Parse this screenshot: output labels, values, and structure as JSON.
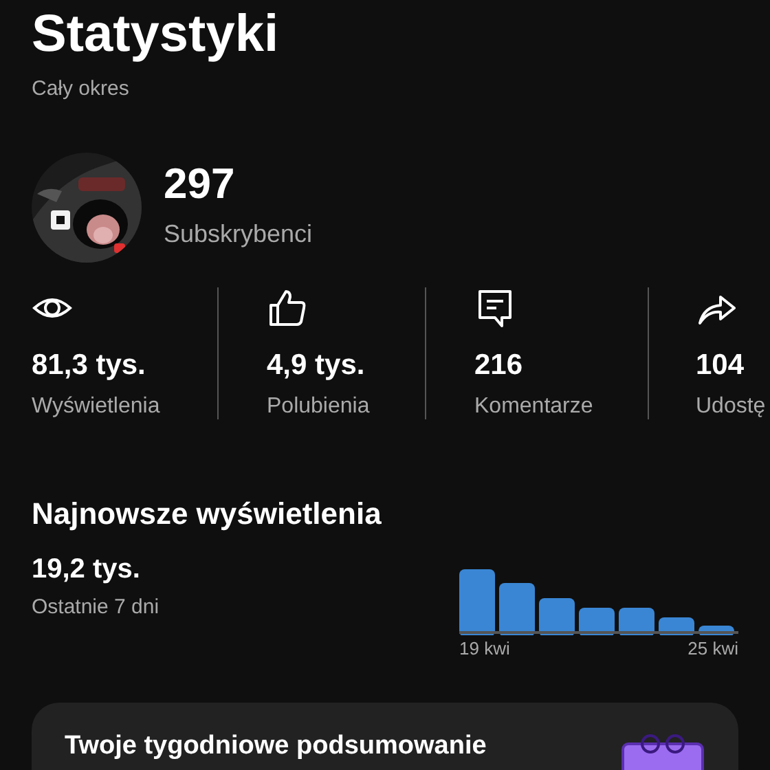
{
  "header": {
    "title": "Statystyki",
    "subtitle": "Cały okres"
  },
  "channel": {
    "count": "297",
    "label": "Subskrybenci"
  },
  "stats": [
    {
      "kind": "views",
      "value": "81,3 tys.",
      "label": "Wyświetlenia"
    },
    {
      "kind": "likes",
      "value": "4,9 tys.",
      "label": "Polubienia"
    },
    {
      "kind": "comments",
      "value": "216",
      "label": "Komentarze"
    },
    {
      "kind": "shares",
      "value": "104",
      "label": "Udostę"
    }
  ],
  "recent_views": {
    "title": "Najnowsze wyświetlenia",
    "value": "19,2 tys.",
    "period": "Ostatnie 7 dni",
    "start_label": "19 kwi",
    "end_label": "25 kwi"
  },
  "weekly_summary": {
    "title": "Twoje tygodniowe podsumowanie"
  }
}
